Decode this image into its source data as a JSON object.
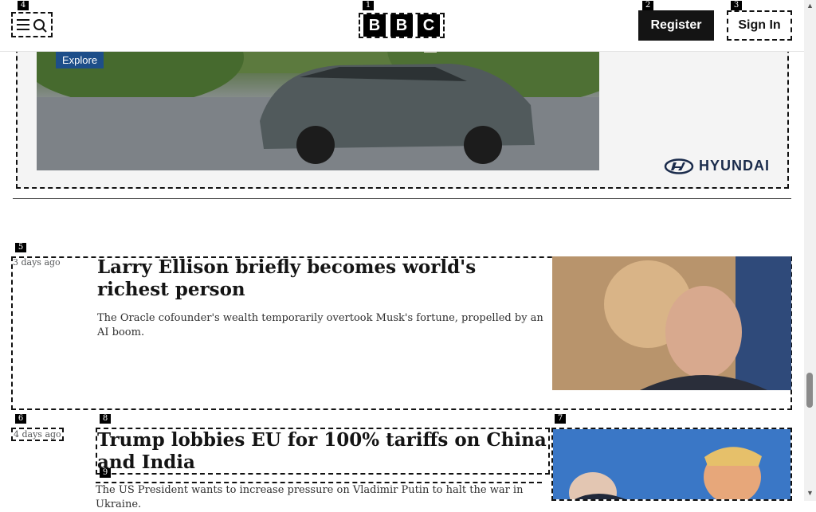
{
  "header": {
    "menu_icon": "menu-search-icon",
    "logo_letters": [
      "B",
      "B",
      "C"
    ],
    "register_label": "Register",
    "signin_label": "Sign In"
  },
  "ad": {
    "explore_label": "Explore",
    "brand": "HYUNDAI"
  },
  "badges": [
    "1",
    "2",
    "3",
    "4",
    "5",
    "6",
    "7",
    "8",
    "9"
  ],
  "articles": [
    {
      "time": "3 days ago",
      "headline": "Larry Ellison briefly becomes world's richest person",
      "summary": "The Oracle cofounder's wealth temporarily overtook Musk's fortune, propelled by an AI boom."
    },
    {
      "time": "4 days ago",
      "headline": "Trump lobbies EU for 100% tariffs on China and India",
      "summary": "The US President wants to increase pressure on Vladimir Putin to halt the war in Ukraine."
    }
  ]
}
